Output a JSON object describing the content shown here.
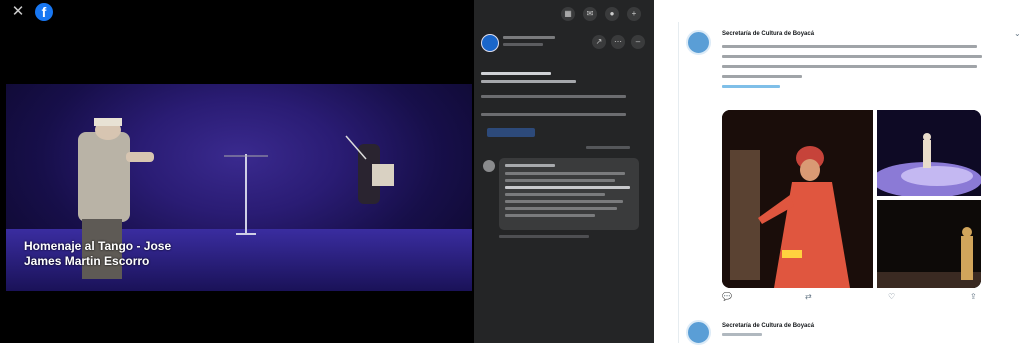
{
  "facebook_viewer": {
    "close_icon": "close-icon",
    "logo_icon": "facebook-logo-icon",
    "photo_caption_line1": "Homenaje al Tango - Jose",
    "photo_caption_line2": "James Martin Escorro",
    "toolbar_icons": [
      "grid-icon",
      "messenger-icon",
      "bell-icon",
      "plus-icon"
    ],
    "post_action_icons": [
      "share-icon",
      "more-icon"
    ]
  },
  "twitter": {
    "name": "Secretaría de Cultura de Boyacá"
  },
  "colors": {
    "facebook_blue": "#1877f2",
    "dark_panel": "#242526",
    "stage_purple": "#2a1c74",
    "twitter_link": "#1b95e0"
  }
}
